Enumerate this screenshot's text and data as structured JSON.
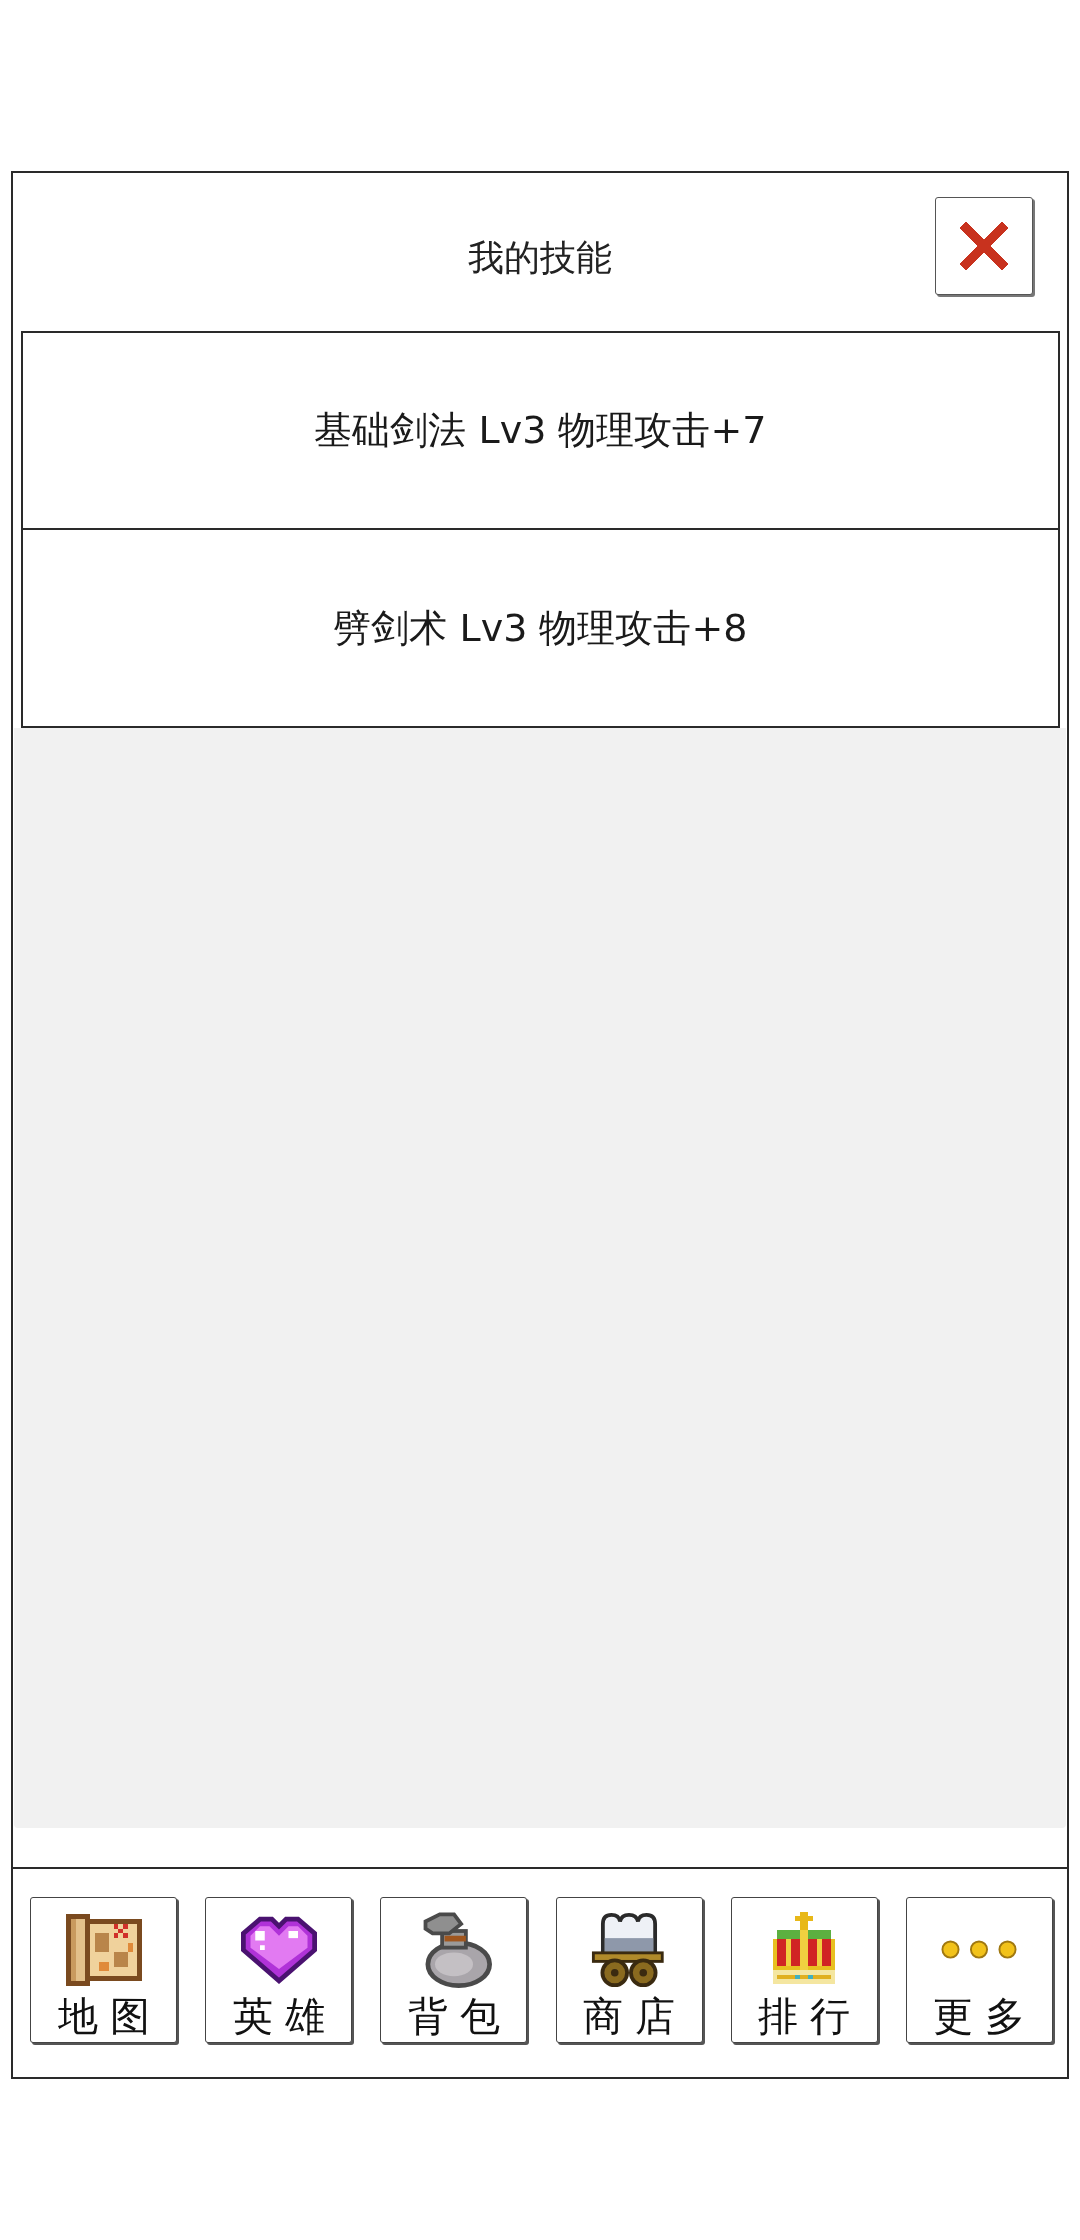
{
  "dialog": {
    "title": "我的技能"
  },
  "skills": [
    {
      "label": "基础剑法 Lv3 物理攻击+7"
    },
    {
      "label": "劈剑术 Lv3 物理攻击+8"
    }
  ],
  "nav": [
    {
      "kind": "map",
      "label": "地图"
    },
    {
      "kind": "heart",
      "label": "英雄"
    },
    {
      "kind": "bag",
      "label": "背包"
    },
    {
      "kind": "wagon",
      "label": "商店"
    },
    {
      "kind": "crown",
      "label": "排行"
    },
    {
      "kind": "coins",
      "label": "更多"
    }
  ]
}
